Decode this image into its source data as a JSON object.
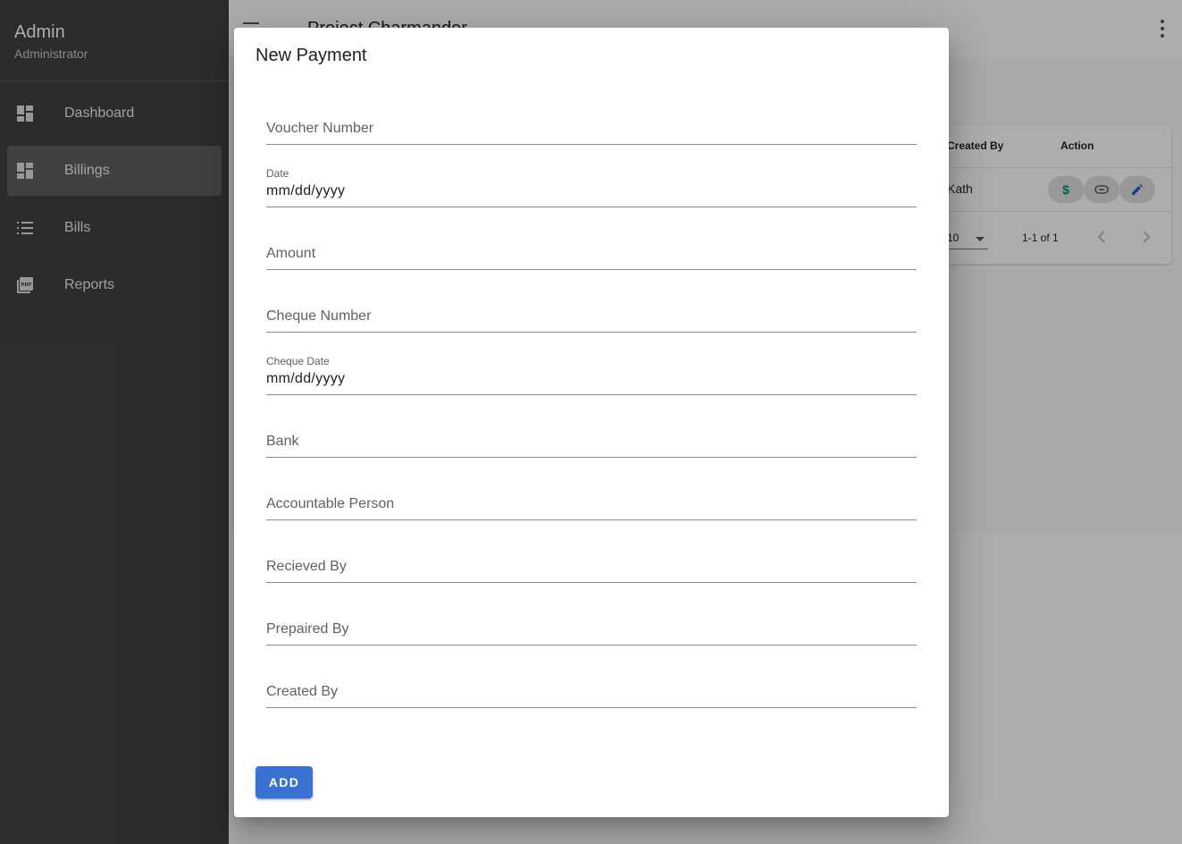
{
  "sidebar": {
    "user_name": "Admin",
    "user_role": "Administrator",
    "items": [
      {
        "label": "Dashboard",
        "icon": "dashboard-icon"
      },
      {
        "label": "Billings",
        "icon": "dashboard-icon",
        "active": true
      },
      {
        "label": "Bills",
        "icon": "list-icon"
      },
      {
        "label": "Reports",
        "icon": "pdf-icon"
      }
    ]
  },
  "appbar": {
    "title": "Project Charmander"
  },
  "table": {
    "headers": {
      "created_by": "Created By",
      "action": "Action"
    },
    "rows": [
      {
        "created_by": "Kath"
      }
    ],
    "rows_per_page": "10",
    "range": "1-1 of 1"
  },
  "dialog": {
    "title": "New Payment",
    "fields": {
      "voucher_number": "Voucher Number",
      "date_label": "Date",
      "date_value": "mm/dd/yyyy",
      "amount": "Amount",
      "cheque_number": "Cheque Number",
      "cheque_date_label": "Cheque Date",
      "cheque_date_value": "mm/dd/yyyy",
      "bank": "Bank",
      "accountable_person": "Accountable Person",
      "recieved_by": "Recieved By",
      "prepaired_by": "Prepaired By",
      "created_by": "Created By"
    },
    "add_label": "ADD"
  },
  "colors": {
    "sidebar_bg": "#424242",
    "primary": "#3a72d1",
    "payment_icon": "#00897b",
    "edit_icon": "#1e5fc8"
  }
}
